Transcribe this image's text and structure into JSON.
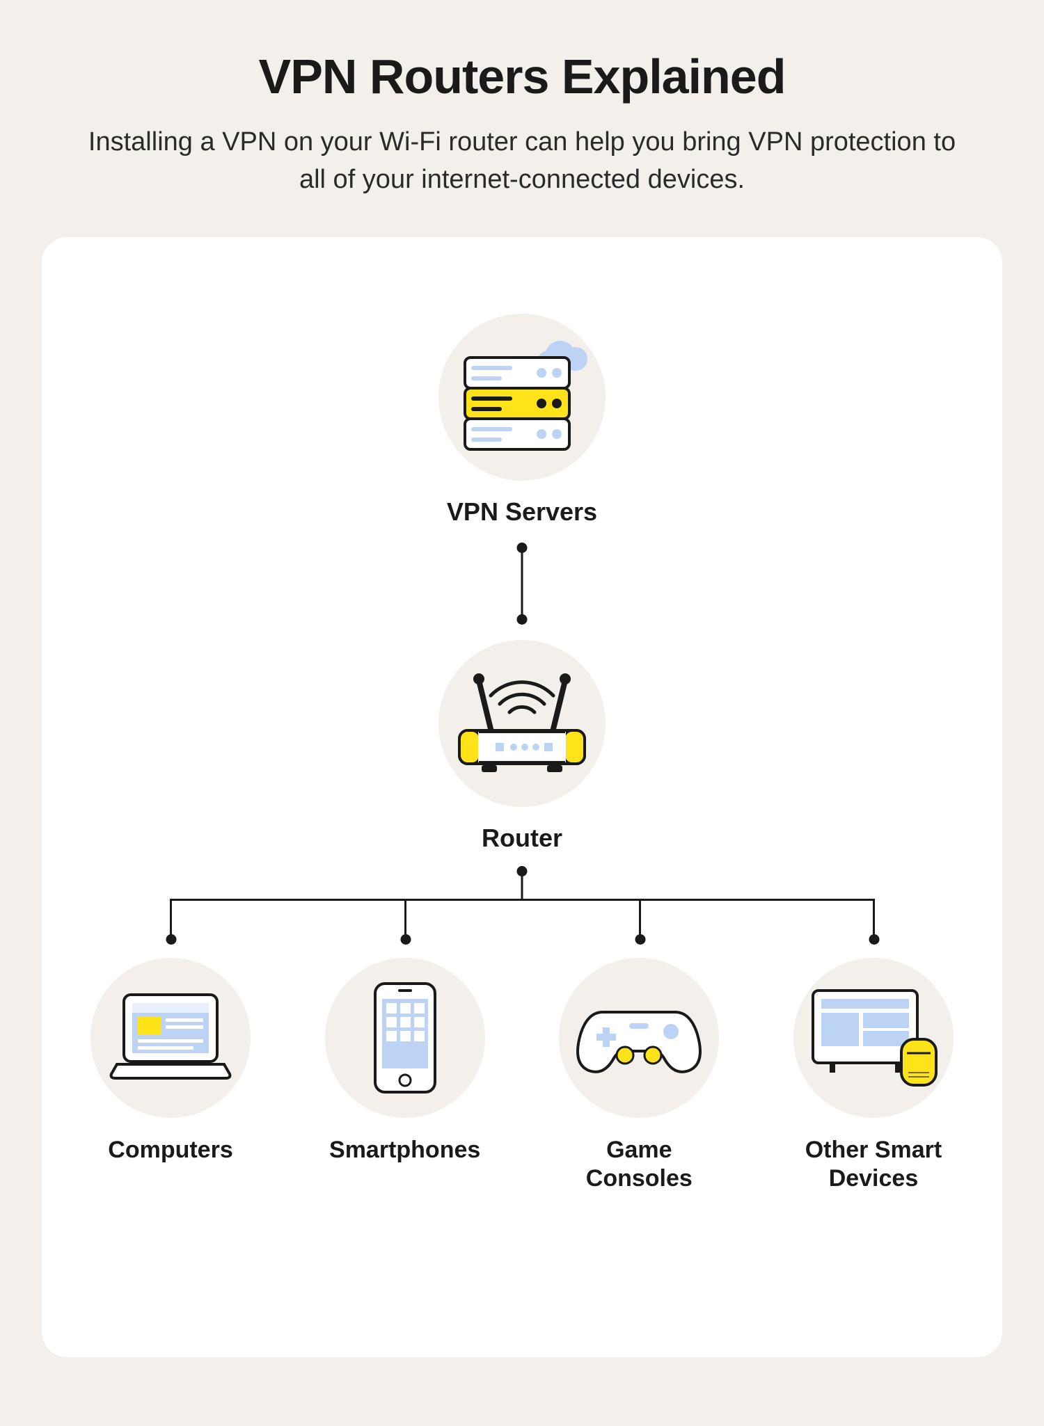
{
  "colors": {
    "bg": "#f3f0ec",
    "card": "#ffffff",
    "ink": "#1a1a1a",
    "blue_light": "#bcd3f5",
    "blue_mid": "#8fb3eb",
    "yellow": "#ffe31a",
    "white": "#ffffff"
  },
  "header": {
    "title": "VPN Routers Explained",
    "subtitle": "Installing a VPN on your Wi-Fi router can help you bring VPN protection to all of your internet-connected devices."
  },
  "diagram": {
    "top_node": {
      "label": "VPN Servers",
      "icon": "server-stack-cloud"
    },
    "mid_node": {
      "label": "Router",
      "icon": "wifi-router"
    },
    "devices": [
      {
        "label": "Computers",
        "icon": "laptop"
      },
      {
        "label": "Smartphones",
        "icon": "smartphone"
      },
      {
        "label": "Game Consoles",
        "icon": "game-controller"
      },
      {
        "label": "Other Smart Devices",
        "icon": "tv-speaker"
      }
    ]
  }
}
